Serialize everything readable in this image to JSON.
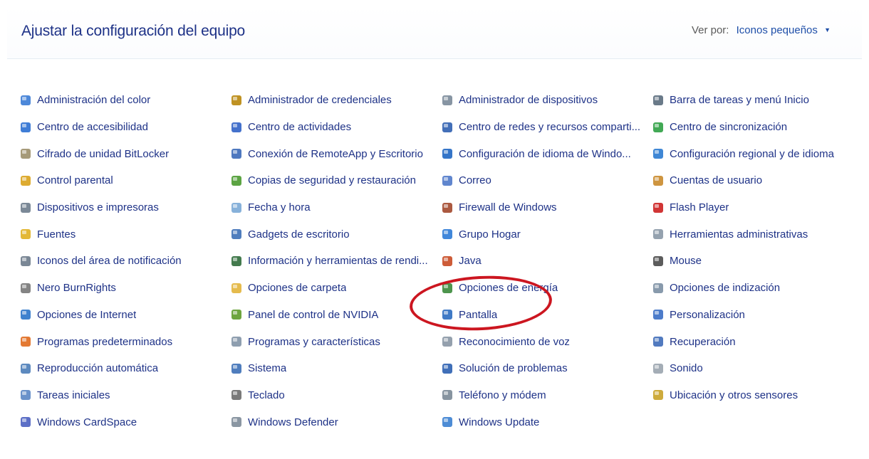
{
  "header": {
    "title": "Ajustar la configuración del equipo",
    "view_by_label": "Ver por:",
    "view_by_value": "Iconos pequeños"
  },
  "items": [
    {
      "label": "Administración del color",
      "icon": "color-management-icon",
      "color": "#3a7bd5"
    },
    {
      "label": "Administrador de credenciales",
      "icon": "credential-manager-icon",
      "color": "#b8860b"
    },
    {
      "label": "Administrador de dispositivos",
      "icon": "device-manager-icon",
      "color": "#7a8a99"
    },
    {
      "label": "Barra de tareas y menú Inicio",
      "icon": "taskbar-icon",
      "color": "#5a6b7c"
    },
    {
      "label": "Centro de accesibilidad",
      "icon": "accessibility-icon",
      "color": "#2a6fd1"
    },
    {
      "label": "Centro de actividades",
      "icon": "action-center-flag-icon",
      "color": "#3062c7"
    },
    {
      "label": "Centro de redes y recursos comparti...",
      "icon": "network-center-icon",
      "color": "#2f5fb0"
    },
    {
      "label": "Centro de sincronización",
      "icon": "sync-center-icon",
      "color": "#2ea043"
    },
    {
      "label": "Cifrado de unidad BitLocker",
      "icon": "bitlocker-key-icon",
      "color": "#9c8f6a"
    },
    {
      "label": "Conexión de RemoteApp y Escritorio",
      "icon": "remoteapp-icon",
      "color": "#3b69b8"
    },
    {
      "label": "Configuración de idioma de Windo...",
      "icon": "language-globe-icon",
      "color": "#1f66c2"
    },
    {
      "label": "Configuración regional y de idioma",
      "icon": "region-globe-icon",
      "color": "#2a7ad0"
    },
    {
      "label": "Control parental",
      "icon": "parental-control-icon",
      "color": "#d9a21b"
    },
    {
      "label": "Copias de seguridad y restauración",
      "icon": "backup-icon",
      "color": "#4a9a2f"
    },
    {
      "label": "Correo",
      "icon": "mail-icon",
      "color": "#4f79c9"
    },
    {
      "label": "Cuentas de usuario",
      "icon": "user-accounts-icon",
      "color": "#c98a2b"
    },
    {
      "label": "Dispositivos e impresoras",
      "icon": "devices-printers-icon",
      "color": "#6d7c8c"
    },
    {
      "label": "Fecha y hora",
      "icon": "date-time-icon",
      "color": "#7aa9d6"
    },
    {
      "label": "Firewall de Windows",
      "icon": "firewall-icon",
      "color": "#a2472b"
    },
    {
      "label": "Flash Player",
      "icon": "flash-player-icon",
      "color": "#cc1f1f"
    },
    {
      "label": "Fuentes",
      "icon": "fonts-icon",
      "color": "#e0b020"
    },
    {
      "label": "Gadgets de escritorio",
      "icon": "desktop-gadgets-icon",
      "color": "#3c6fb6"
    },
    {
      "label": "Grupo Hogar",
      "icon": "homegroup-icon",
      "color": "#2c7ad6"
    },
    {
      "label": "Herramientas administrativas",
      "icon": "admin-tools-icon",
      "color": "#8a98a6"
    },
    {
      "label": "Iconos del área de notificación",
      "icon": "notification-area-icon",
      "color": "#6b7a89"
    },
    {
      "label": "Información y herramientas de rendi...",
      "icon": "performance-icon",
      "color": "#2f6b3a"
    },
    {
      "label": "Java",
      "icon": "java-icon",
      "color": "#c84a22"
    },
    {
      "label": "Mouse",
      "icon": "mouse-icon",
      "color": "#4a4a4a"
    },
    {
      "label": "Nero BurnRights",
      "icon": "nero-icon",
      "color": "#777777"
    },
    {
      "label": "Opciones de carpeta",
      "icon": "folder-options-icon",
      "color": "#e2b43a"
    },
    {
      "label": "Opciones de energía",
      "icon": "power-options-icon",
      "color": "#3a8a3a"
    },
    {
      "label": "Opciones de indización",
      "icon": "indexing-icon",
      "color": "#7b8fa3"
    },
    {
      "label": "Opciones de Internet",
      "icon": "internet-options-icon",
      "color": "#2a74c9"
    },
    {
      "label": "Panel de control de NVIDIA",
      "icon": "nvidia-icon",
      "color": "#5e9b2a"
    },
    {
      "label": "Pantalla",
      "icon": "display-icon",
      "color": "#2b6cc0"
    },
    {
      "label": "Personalización",
      "icon": "personalization-icon",
      "color": "#3a6ec4"
    },
    {
      "label": "Programas predeterminados",
      "icon": "default-programs-icon",
      "color": "#e06a1d"
    },
    {
      "label": "Programas y características",
      "icon": "programs-features-icon",
      "color": "#8294a6"
    },
    {
      "label": "Reconocimiento de voz",
      "icon": "speech-recognition-icon",
      "color": "#8896a4"
    },
    {
      "label": "Recuperación",
      "icon": "recovery-icon",
      "color": "#3e6bb8"
    },
    {
      "label": "Reproducción automática",
      "icon": "autoplay-icon",
      "color": "#4b7db8"
    },
    {
      "label": "Sistema",
      "icon": "system-icon",
      "color": "#3c6fb6"
    },
    {
      "label": "Solución de problemas",
      "icon": "troubleshooting-icon",
      "color": "#2b5fb0"
    },
    {
      "label": "Sonido",
      "icon": "sound-icon",
      "color": "#9aa4ae"
    },
    {
      "label": "Tareas iniciales",
      "icon": "getting-started-icon",
      "color": "#5a86c4"
    },
    {
      "label": "Teclado",
      "icon": "keyboard-icon",
      "color": "#6c6c6c"
    },
    {
      "label": "Teléfono y módem",
      "icon": "phone-modem-icon",
      "color": "#7a8896"
    },
    {
      "label": "Ubicación y otros sensores",
      "icon": "location-sensors-icon",
      "color": "#c9a227"
    },
    {
      "label": "Windows CardSpace",
      "icon": "cardspace-icon",
      "color": "#4a5fc0"
    },
    {
      "label": "Windows Defender",
      "icon": "windows-defender-icon",
      "color": "#7d8b98"
    },
    {
      "label": "Windows Update",
      "icon": "windows-update-icon",
      "color": "#3a7fd0"
    }
  ],
  "highlighted_item": "Pantalla",
  "highlight_color": "#cc1620"
}
